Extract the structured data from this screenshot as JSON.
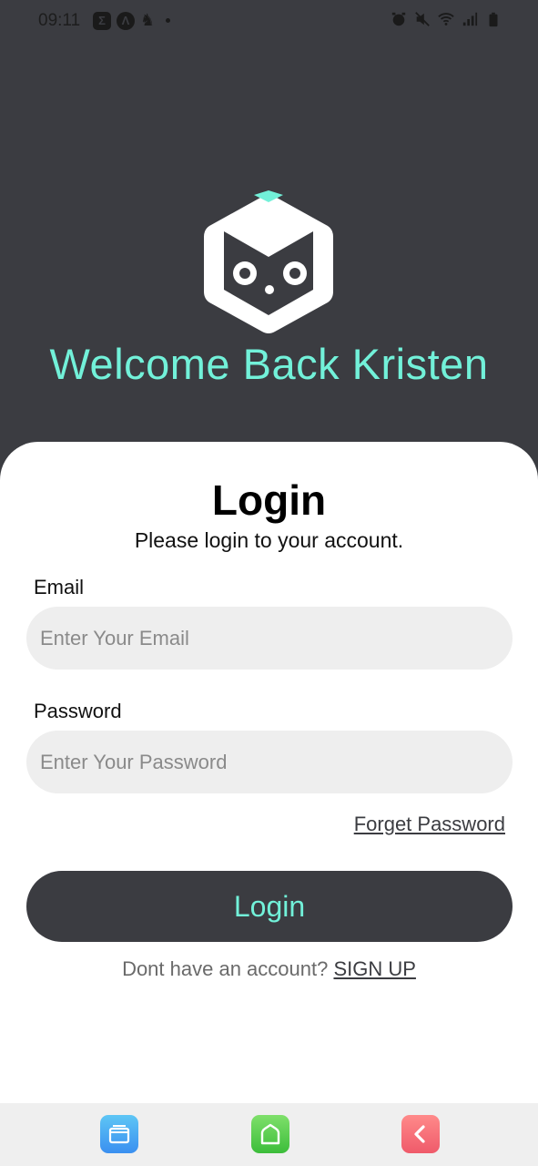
{
  "status_bar": {
    "time": "09:11",
    "left_icons": [
      "sigma-icon",
      "lambda-icon",
      "person-icon"
    ],
    "right_icons": [
      "alarm-icon",
      "mute-icon",
      "wifi-icon",
      "signal-icon",
      "battery-icon"
    ]
  },
  "header": {
    "logo_icon": "owl-cube-logo",
    "welcome_text": "Welcome Back Kristen",
    "accent_color": "#72f1d9",
    "background_color": "#3b3c41"
  },
  "login_card": {
    "title": "Login",
    "subtitle": "Please login to your account.",
    "email_label": "Email",
    "email_placeholder": "Enter Your Email",
    "email_value": "",
    "password_label": "Password",
    "password_placeholder": "Enter Your Password",
    "password_value": "",
    "forget_password": "Forget Password",
    "login_button": "Login",
    "signup_prompt": "Dont have an account?",
    "signup_link": "SIGN UP"
  },
  "nav_bar": {
    "buttons": [
      "recent-apps-icon",
      "home-icon",
      "back-icon"
    ]
  }
}
